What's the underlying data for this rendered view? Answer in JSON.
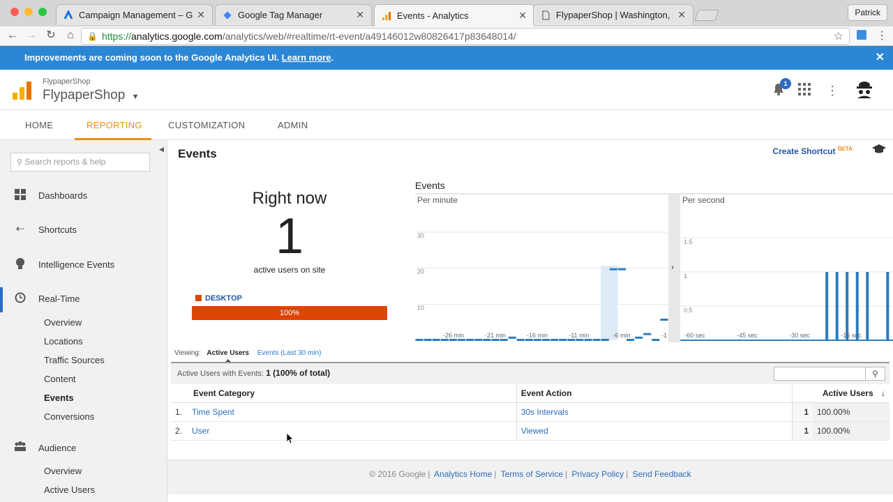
{
  "browser": {
    "tabs": [
      {
        "title": "Campaign Management – Goo",
        "icon": "google-ads-icon"
      },
      {
        "title": "Google Tag Manager",
        "icon": "tag-manager-icon"
      },
      {
        "title": "Events - Analytics",
        "icon": "analytics-icon",
        "active": true
      },
      {
        "title": "FlypaperShop | Washington, D",
        "icon": "page-icon"
      }
    ],
    "profile": "Patrick",
    "url_scheme": "https://",
    "url_host": "analytics.google.com",
    "url_path": "/analytics/web/#realtime/rt-event/a49146012w80826417p83648014/"
  },
  "notice": {
    "text": "Improvements are coming soon to the Google Analytics UI.",
    "link": "Learn more",
    "suffix": "."
  },
  "header": {
    "account_small": "FlypaperShop",
    "account_big": "FlypaperShop",
    "notification_count": "1"
  },
  "nav": {
    "home": "HOME",
    "reporting": "REPORTING",
    "customization": "CUSTOMIZATION",
    "admin": "ADMIN"
  },
  "sidebar": {
    "search_placeholder": "Search reports & help",
    "items": [
      {
        "label": "Dashboards"
      },
      {
        "label": "Shortcuts"
      },
      {
        "label": "Intelligence Events"
      },
      {
        "label": "Real-Time"
      },
      {
        "label": "Audience"
      }
    ],
    "realtime_sub": [
      "Overview",
      "Locations",
      "Traffic Sources",
      "Content",
      "Events",
      "Conversions"
    ],
    "audience_sub": [
      "Overview",
      "Active Users"
    ]
  },
  "main": {
    "title": "Events",
    "create_shortcut": "Create Shortcut",
    "beta": "BETA",
    "right_now": "Right now",
    "active_users": "1",
    "active_users_label": "active users on site",
    "device_label": "DESKTOP",
    "device_pct": "100%",
    "viewing_label": "Viewing:",
    "viewing_current": "Active Users",
    "viewing_alt": "Events (Last 30 min)",
    "summary_label": "Active Users with Events:",
    "summary_value": "1 (100% of total)"
  },
  "table": {
    "headers": {
      "category": "Event Category",
      "action": "Event Action",
      "users": "Active Users"
    },
    "rows": [
      {
        "idx": "1.",
        "category": "Time Spent",
        "action": "30s Intervals",
        "users": "1",
        "pct": "100.00%"
      },
      {
        "idx": "2.",
        "category": "User",
        "action": "Viewed",
        "users": "1",
        "pct": "100.00%"
      }
    ]
  },
  "footer": {
    "copyright": "© 2016 Google",
    "links": [
      "Analytics Home",
      "Terms of Service",
      "Privacy Policy",
      "Send Feedback"
    ]
  },
  "colors": {
    "accent": "#e8910c",
    "notice_blue": "#2b87d6",
    "bar": "#2b7bbf",
    "desktop": "#e04303"
  },
  "chart_data": [
    {
      "type": "bar",
      "title": "Events",
      "subtitle": "Per minute",
      "ylim": [
        0,
        30
      ],
      "yticks": [
        10,
        20,
        30
      ],
      "xticks": [
        "-26 min",
        "-21 min",
        "-16 min",
        "-11 min",
        "-6 min",
        "-1"
      ],
      "x": [
        -29,
        -28,
        -27,
        -26,
        -25,
        -24,
        -23,
        -22,
        -21,
        -20,
        -19,
        -18,
        -17,
        -16,
        -15,
        -14,
        -13,
        -12,
        -11,
        -10,
        -9,
        -8,
        -7,
        -6,
        -5,
        -4,
        -3,
        -2,
        -1,
        0
      ],
      "values": [
        0,
        0,
        0,
        0,
        0,
        0,
        0,
        0,
        0,
        0,
        0,
        1,
        0,
        0,
        0,
        0,
        0,
        0,
        0,
        0,
        0,
        0,
        0,
        20,
        20,
        0,
        1,
        2,
        0,
        6
      ],
      "highlight": [
        -7,
        -6
      ]
    },
    {
      "type": "bar",
      "subtitle": "Per second",
      "ylim": [
        0,
        1.5
      ],
      "yticks": [
        0.5,
        1,
        1.5
      ],
      "xticks": [
        "-60 sec",
        "-45 sec",
        "-30 sec",
        "-15 sec"
      ],
      "x": [
        -20,
        -17,
        -14,
        -11,
        -8,
        -2
      ],
      "values": [
        1,
        1,
        1,
        1,
        1,
        1
      ]
    }
  ]
}
